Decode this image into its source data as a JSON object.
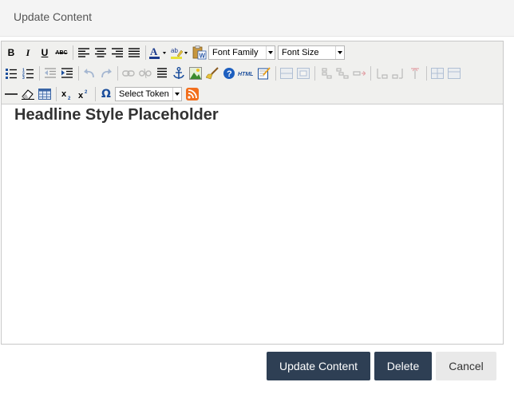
{
  "dialog": {
    "title": "Update Content"
  },
  "toolbar": {
    "bold_label": "B",
    "italic_label": "I",
    "underline_label": "U",
    "strikethrough_label": "ABC",
    "font_family": "Font Family",
    "font_size": "Font Size",
    "token": "Select Token",
    "html_label": "HTML",
    "omega_label": "Ω"
  },
  "editor": {
    "content_heading": "Headline Style Placeholder"
  },
  "footer": {
    "update_label": "Update Content",
    "delete_label": "Delete",
    "cancel_label": "Cancel"
  },
  "colors": {
    "header_bg": "#f4f4f4",
    "toolbar_bg": "#f0f0ee",
    "primary_button": "#2e3f54",
    "secondary_button": "#e9e9e9",
    "heading_text": "#333333"
  }
}
